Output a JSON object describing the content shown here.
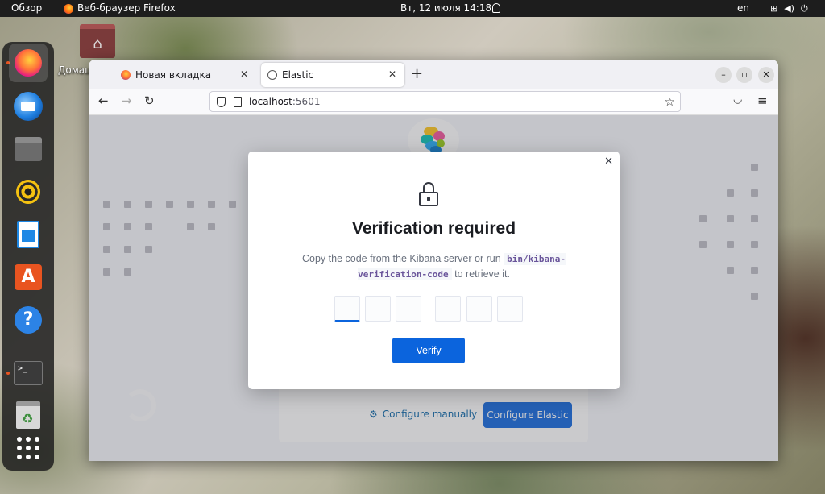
{
  "topbar": {
    "activities": "Обзор",
    "app_name": "Веб-браузер Firefox",
    "clock": "Вт, 12 июля  14:18",
    "language": "en"
  },
  "desktop": {
    "home_label": "Домашняя папка"
  },
  "browser": {
    "tabs": [
      {
        "label": "Новая вкладка"
      },
      {
        "label": "Elastic"
      }
    ],
    "url_host": "localhost",
    "url_port": ":5601"
  },
  "page": {
    "configure_manually": "Configure manually",
    "configure_elastic": "Configure Elastic"
  },
  "modal": {
    "title": "Verification required",
    "desc_before": "Copy the code from the Kibana server or run ",
    "desc_code": "bin/kibana-verification-code",
    "desc_after": " to retrieve it.",
    "verify_label": "Verify",
    "code_values": [
      "",
      "",
      "",
      "",
      "",
      ""
    ]
  },
  "colors": {
    "primary": "#0b64dd",
    "topbar": "#1d1d1d",
    "accent_ubuntu": "#e95420"
  }
}
